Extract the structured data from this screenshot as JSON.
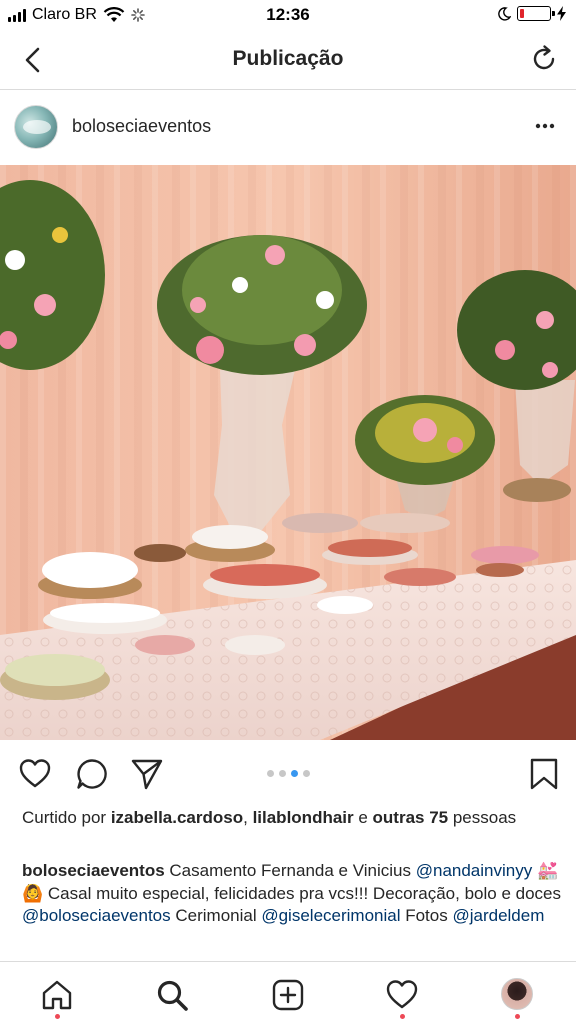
{
  "status_bar": {
    "carrier": "Claro BR",
    "time": "12:36",
    "battery_level": 0.15,
    "battery_color": "#e0242b"
  },
  "nav": {
    "title": "Publicação",
    "back_icon": "chevron-left-icon",
    "refresh_icon": "refresh-icon"
  },
  "post": {
    "username": "boloseciaeventos",
    "more_icon": "more-horizontal-icon",
    "photo_alt": "photo",
    "carousel": {
      "count": 4,
      "active_index": 2,
      "active_color": "#3897f0"
    },
    "likes": {
      "prefix": "Curtido por ",
      "user1": "izabella.cardoso",
      "sep": ", ",
      "user2": "lilablondhair",
      "middle": " e ",
      "others": "outras 75",
      "suffix": " pessoas"
    },
    "caption": {
      "user": "boloseciaeventos",
      "text1": " Casamento Fernanda e Vinicius ",
      "mention1": "@nandainvinyy",
      "emojis": " 💒🙆 ",
      "text2": "Casal muito especial, felicidades pra vcs!!! Decoração, bolo e doces ",
      "mention2": "@boloseciaeventos",
      "text3": " Cerimonial ",
      "mention3": "@giselecerimonial",
      "text4": " Fotos ",
      "mention4": "@jardeldem"
    }
  },
  "tab_bar": {
    "items": [
      "home-icon",
      "search-icon",
      "add-post-icon",
      "activity-heart-icon",
      "profile-avatar"
    ],
    "notification_color": "#ed4956"
  }
}
